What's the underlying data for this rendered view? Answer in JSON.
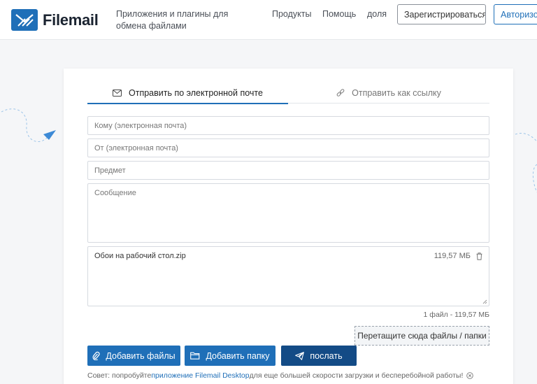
{
  "header": {
    "logo_text": "Filemail",
    "nav_apps": "Приложения и плагины для обмена файлами",
    "nav_products": "Продукты",
    "nav_help": "Помощь",
    "nav_share": "доля",
    "register_label": "Зарегистрироваться",
    "login_label": "Авторизоваться"
  },
  "tabs": {
    "email_label": "Отправить по электронной почте",
    "link_label": "Отправить как ссылку"
  },
  "form": {
    "to_placeholder": "Кому (электронная почта)",
    "from_placeholder": "От (электронная почта)",
    "subject_placeholder": "Предмет",
    "message_placeholder": "Сообщение"
  },
  "files": {
    "items": [
      {
        "name": "Обои на рабочий стол.zip",
        "size": "119,57 МБ"
      }
    ],
    "summary": "1 файл - 119,57 МБ",
    "dropzone_label": "Перетащите сюда файлы / папки"
  },
  "actions": {
    "add_files_label": "Добавить файлы",
    "add_folder_label": "Добавить папку",
    "send_label": "послать"
  },
  "tip": {
    "prefix": "Совет: попробуйте ",
    "link": "приложение Filemail Desktop",
    "suffix": " для еще большей скорости загрузки и бесперебойной работы!"
  },
  "colors": {
    "accent": "#1f6fb8",
    "send": "#134b86"
  },
  "icons": {
    "tab_email": "envelope-icon",
    "tab_link": "link-icon",
    "delete_file": "trash-icon",
    "add_files": "paperclip-icon",
    "add_folder": "folder-icon",
    "send": "paper-plane-icon",
    "dismiss_tip": "close-circle-icon"
  }
}
